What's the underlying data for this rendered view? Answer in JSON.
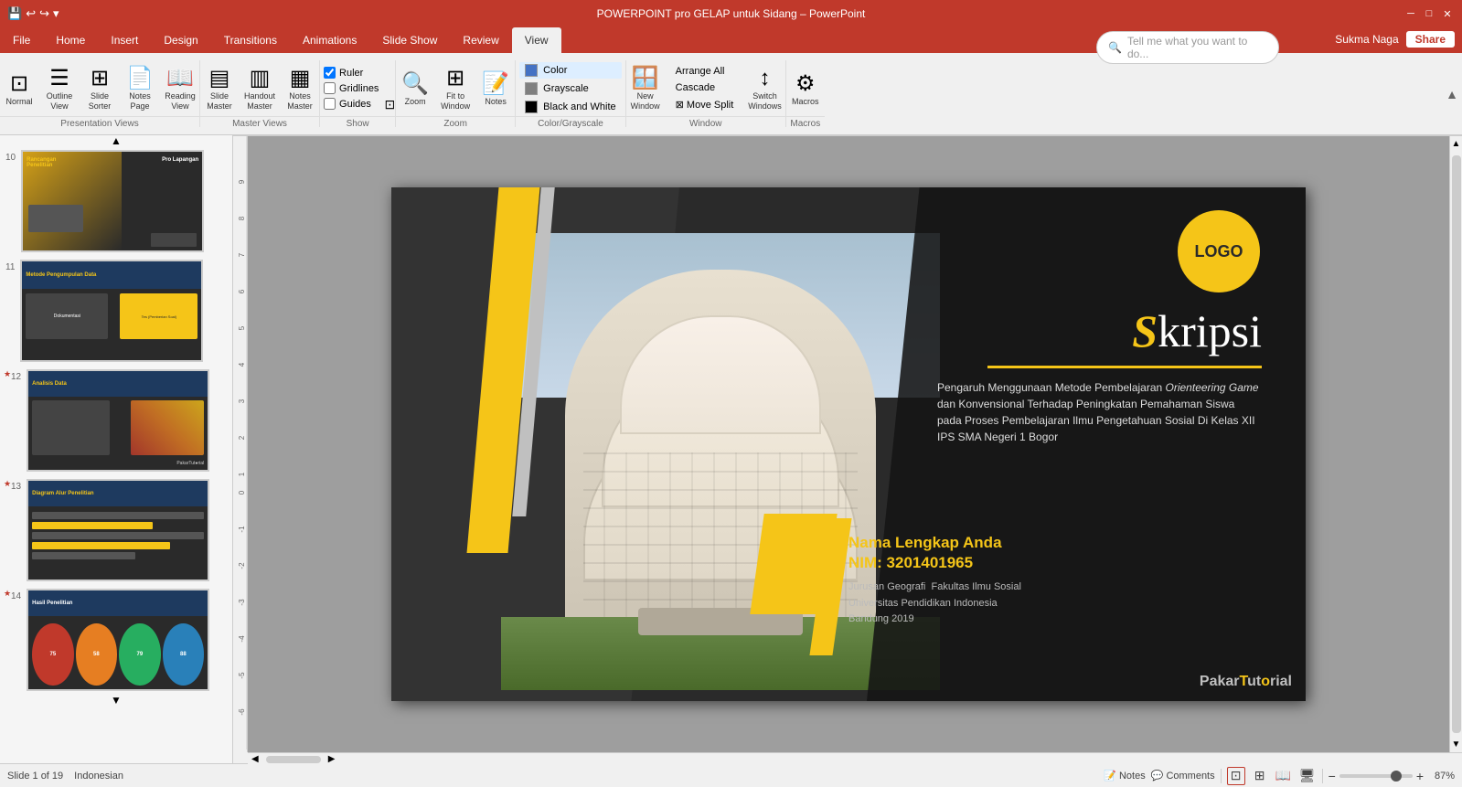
{
  "titleBar": {
    "title": "POWERPOINT pro GELAP untuk Sidang – PowerPoint",
    "quickAccess": [
      "💾",
      "↩",
      "↪",
      "⚙"
    ],
    "winControls": [
      "─",
      "□",
      "✕"
    ]
  },
  "ribbonTabs": {
    "tabs": [
      "File",
      "Home",
      "Insert",
      "Design",
      "Transitions",
      "Animations",
      "Slide Show",
      "Review",
      "View"
    ],
    "activeTab": "View"
  },
  "ribbon": {
    "presentationViews": {
      "label": "Presentation Views",
      "buttons": [
        {
          "id": "normal",
          "icon": "⊞",
          "label": "Normal"
        },
        {
          "id": "outline",
          "icon": "☰",
          "label": "Outline\nView"
        },
        {
          "id": "slide-sorter",
          "icon": "⊟",
          "label": "Slide\nSorter"
        },
        {
          "id": "notes-page",
          "icon": "📄",
          "label": "Notes\nPage"
        },
        {
          "id": "reading",
          "icon": "📖",
          "label": "Reading\nView"
        }
      ]
    },
    "masterViews": {
      "label": "Master Views",
      "buttons": [
        {
          "id": "slide-master",
          "icon": "▤",
          "label": "Slide\nMaster"
        },
        {
          "id": "handout-master",
          "icon": "▥",
          "label": "Handout\nMaster"
        },
        {
          "id": "notes-master",
          "icon": "▦",
          "label": "Notes\nMaster"
        }
      ]
    },
    "show": {
      "label": "Show",
      "checkboxes": [
        {
          "id": "ruler",
          "label": "Ruler",
          "checked": true
        },
        {
          "id": "gridlines",
          "label": "Gridlines",
          "checked": false
        },
        {
          "id": "guides",
          "label": "Guides",
          "checked": false
        }
      ],
      "expandIcon": "⊡"
    },
    "zoom": {
      "label": "Zoom",
      "buttons": [
        {
          "id": "zoom-btn",
          "icon": "🔍",
          "label": "Zoom"
        },
        {
          "id": "fit-window",
          "icon": "⊞",
          "label": "Fit to\nWindow"
        }
      ]
    },
    "colorGrayscale": {
      "label": "Color/Grayscale",
      "buttons": [
        {
          "id": "color",
          "label": "Color",
          "swatch": "#4472C4",
          "active": true
        },
        {
          "id": "grayscale",
          "label": "Grayscale",
          "swatch": "#808080"
        },
        {
          "id": "black-white",
          "label": "Black and White",
          "swatch": "#000000"
        }
      ]
    },
    "window": {
      "label": "Window",
      "buttons": [
        {
          "id": "new-window",
          "icon": "🪟",
          "label": "New\nWindow"
        },
        {
          "id": "arrange-all",
          "icon": "⊞",
          "label": "Arrange All"
        },
        {
          "id": "cascade",
          "icon": "⧉",
          "label": "Cascade"
        },
        {
          "id": "move-split",
          "icon": "⊠",
          "label": "Move Split"
        },
        {
          "id": "switch-windows",
          "icon": "🔀",
          "label": "Switch\nWindows"
        }
      ]
    },
    "macros": {
      "label": "Macros",
      "buttons": [
        {
          "id": "macros-btn",
          "icon": "⚙",
          "label": "Macros"
        }
      ]
    }
  },
  "tellMe": {
    "placeholder": "Tell me what you want to do..."
  },
  "userArea": {
    "name": "Sukma Naga",
    "shareLabel": "Share"
  },
  "slidePanel": {
    "slides": [
      {
        "num": 10,
        "starred": false,
        "label": "Rancangan Penelitian"
      },
      {
        "num": 11,
        "starred": false,
        "label": "Metode Pengumpulan Data"
      },
      {
        "num": 12,
        "starred": true,
        "label": "Analisis Data"
      },
      {
        "num": 13,
        "starred": true,
        "label": "Diagram Alur Penelitian"
      },
      {
        "num": 14,
        "starred": true,
        "label": "Hasil Penelitian"
      }
    ]
  },
  "mainSlide": {
    "logoText": "LOGO",
    "title": "Skripsi",
    "titleSLetter": "S",
    "titleRest": "kripsi",
    "subtitle": "Pengaruh Menggunaan Metode Pembelajaran Orienteering Game dan Konvensional Terhadap Peningkatan Pemahaman Siswa pada Proses Pembelajaran Ilmu Pengetahuan Sosial Di Kelas XII IPS SMA Negeri 1 Bogor",
    "authorName": "Nama Lengkap Anda",
    "authorNIM": "NIM: 3201401965",
    "affiliation": "Jurusan Geografi  Fakultas Ilmu Sosial\nUniversitas Pendidikan Indonesia\nBandung 2019",
    "brandText": "PakarTutorial",
    "brandHighlight": "o"
  },
  "statusBar": {
    "slideInfo": "Slide 1 of 19",
    "language": "Indonesian",
    "notesLabel": "Notes",
    "commentsLabel": "Comments",
    "viewButtons": [
      "normal",
      "slide-sorter",
      "reading",
      "presenter"
    ],
    "zoom": "87%",
    "zoomMinus": "−",
    "zoomPlus": "+"
  },
  "colors": {
    "yellow": "#f5c518",
    "dark": "#2a2a2a",
    "accent": "#c0392b",
    "white": "#ffffff",
    "gray": "#808080"
  }
}
